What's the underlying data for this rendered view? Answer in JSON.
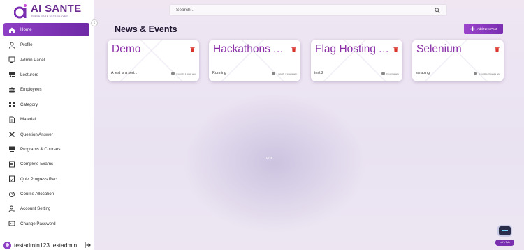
{
  "app": {
    "name": "AI SANTE",
    "tagline": "WHERE CARE GETS CLEVER",
    "colors": {
      "accent": "#8e3fc4",
      "title": "#8a2fa6",
      "delete": "#d9342b"
    }
  },
  "sidebar": {
    "collapse_icon": "chevron-left-icon",
    "items": [
      {
        "label": "Home",
        "icon": "home-icon",
        "active": true
      },
      {
        "label": "Profile",
        "icon": "user-icon",
        "active": false
      },
      {
        "label": "Admin Panel",
        "icon": "dashboard-icon",
        "active": false
      },
      {
        "label": "Lecturers",
        "icon": "lecturer-icon",
        "active": false
      },
      {
        "label": "Employees",
        "icon": "group-icon",
        "active": false
      },
      {
        "label": "Category",
        "icon": "grid-icon",
        "active": false
      },
      {
        "label": "Material",
        "icon": "document-icon",
        "active": false
      },
      {
        "label": "Question Answer",
        "icon": "tools-icon",
        "active": false
      },
      {
        "label": "Programs & Courses",
        "icon": "courses-icon",
        "active": false
      },
      {
        "label": "Complete Exams",
        "icon": "exam-icon",
        "active": false
      },
      {
        "label": "Quiz Progress Rec",
        "icon": "progress-icon",
        "active": false
      },
      {
        "label": "Course Allocation",
        "icon": "allocation-icon",
        "active": false
      },
      {
        "label": "Account Setting",
        "icon": "account-icon",
        "active": false
      },
      {
        "label": "Change Password",
        "icon": "password-icon",
        "active": false
      }
    ],
    "user": {
      "name": "testadmin123 testadmin",
      "logout_icon": "logout-icon"
    }
  },
  "header": {
    "search_placeholder": "Search...",
    "title": "News & Events",
    "add_button_label": "Add New Post"
  },
  "cards": [
    {
      "title": "Demo",
      "description": "A test is a seri...",
      "meta": "1 month, 1 week ago"
    },
    {
      "title": "Hackathons A...",
      "description": "Running",
      "meta": "1 month, 4 weeks ago"
    },
    {
      "title": "Flag Hosting A...",
      "description": "test 2",
      "meta": "3 months ago"
    },
    {
      "title": "Selenium",
      "description": "scraping",
      "meta": "3 months, 3 weeks ago"
    }
  ],
  "status": {
    "loading_text": "one"
  },
  "chat": {
    "label": "Let's Talk"
  }
}
